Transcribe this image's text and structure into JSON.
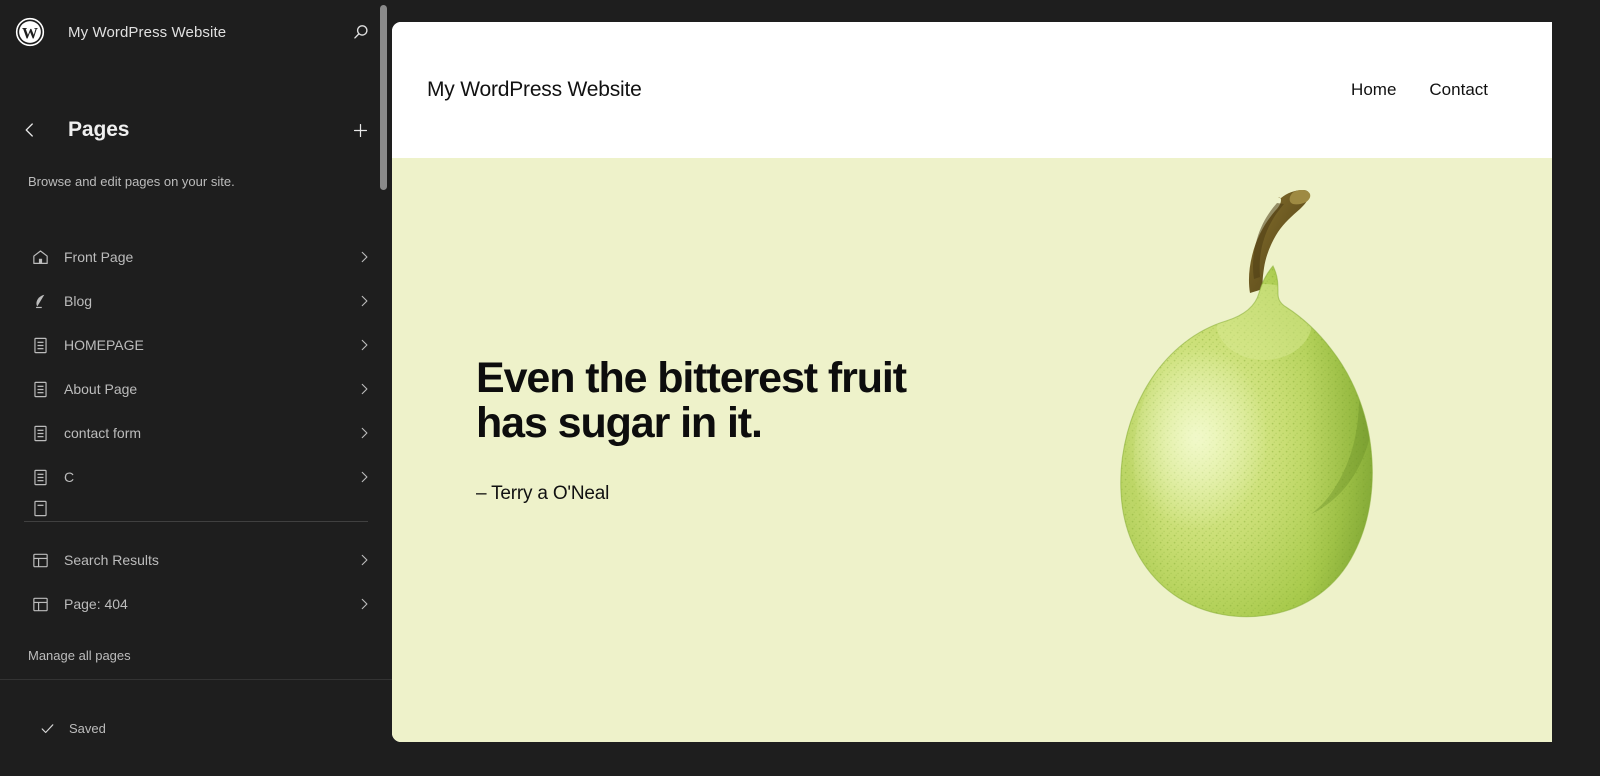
{
  "sidebar": {
    "site_title": "My WordPress Website",
    "logo_icon": "wordpress-logo-icon",
    "search_icon": "search-icon",
    "back_icon": "chevron-left-icon",
    "add_icon": "plus-icon",
    "panel_title": "Pages",
    "panel_description": "Browse and edit pages on your site.",
    "items": [
      {
        "label": "Front Page",
        "icon": "home-icon"
      },
      {
        "label": "Blog",
        "icon": "quill-icon"
      },
      {
        "label": "HOMEPAGE",
        "icon": "page-icon"
      },
      {
        "label": "About Page",
        "icon": "page-icon"
      },
      {
        "label": "contact form",
        "icon": "page-icon"
      },
      {
        "label": "C",
        "icon": "page-icon"
      }
    ],
    "items_lower": [
      {
        "label": "Search Results",
        "icon": "template-icon"
      },
      {
        "label": "Page: 404",
        "icon": "template-icon"
      }
    ],
    "manage_link": "Manage all pages",
    "footer": {
      "status_label": "Saved",
      "status_icon": "check-icon"
    }
  },
  "preview": {
    "site_title": "My WordPress Website",
    "nav": [
      {
        "label": "Home"
      },
      {
        "label": "Contact"
      }
    ],
    "hero": {
      "quote_line_1": "Even the bitterest fruit",
      "quote_line_2": "has sugar in it.",
      "citation": "– Terry a O'Neal",
      "background_color": "#eef2ca",
      "image_alt": "pear-illustration"
    }
  },
  "colors": {
    "sidebar_background": "#1e1e1e",
    "canvas_background": "#1e1e1e",
    "hero_background": "#eef2ca",
    "text_primary": "#f0f0f0",
    "text_secondary": "#bcbcbc",
    "divider": "#404040"
  }
}
